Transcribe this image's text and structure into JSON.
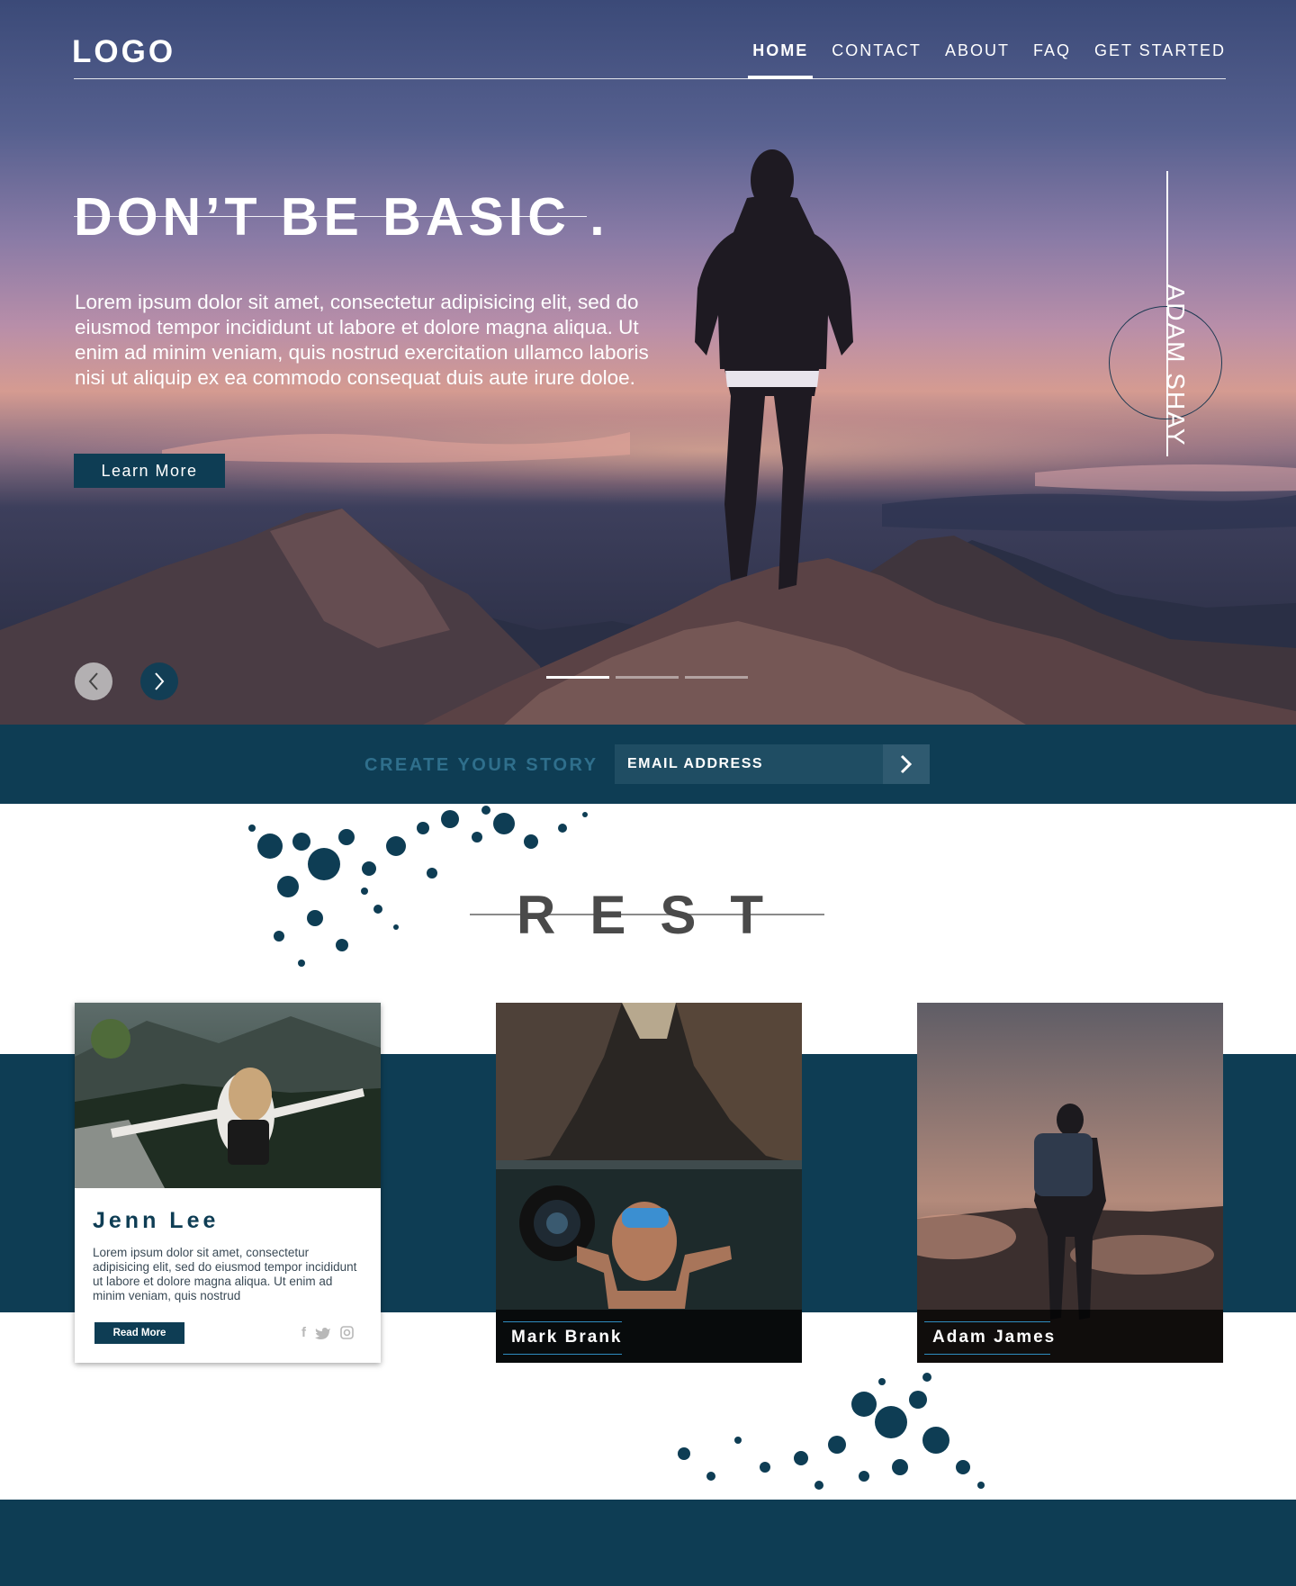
{
  "colors": {
    "primary": "#0e3d54",
    "accent": "#2f6f8c",
    "caption_rule": "#2f8cc0"
  },
  "header": {
    "logo": "LOGO",
    "nav": [
      {
        "label": "HOME",
        "active": true
      },
      {
        "label": "CONTACT",
        "active": false
      },
      {
        "label": "ABOUT",
        "active": false
      },
      {
        "label": "FAQ",
        "active": false
      },
      {
        "label": "GET STARTED",
        "active": false
      }
    ]
  },
  "hero": {
    "headline": "DON’T BE BASIC .",
    "body": "Lorem ipsum dolor sit amet, consectetur adipisicing elit, sed do eiusmod tempor incididunt ut labore et dolore magna aliqua. Ut enim ad minim veniam, quis nostrud exercitation ullamco laboris nisi ut aliquip ex ea commodo consequat duis aute irure doloe.",
    "button_label": "Learn More",
    "side_name": "ADAM SHAY",
    "slides": {
      "count": 3,
      "active_index": 0
    },
    "icons": {
      "prev": "chevron-left-icon",
      "next": "chevron-right-icon"
    }
  },
  "subscribe": {
    "cta": "CREATE YOUR STORY",
    "email_placeholder": "EMAIL ADDRESS",
    "submit_icon": "chevron-right-icon"
  },
  "section": {
    "title": "REST"
  },
  "cards": [
    {
      "name": "Jenn Lee",
      "text": "Lorem ipsum dolor sit amet, consectetur adipisicing elit, sed do eiusmod tempor incididunt ut labore et dolore magna aliqua. Ut enim ad minim veniam, quis nostrud",
      "button_label": "Read More",
      "socials": [
        "facebook-icon",
        "twitter-icon",
        "instagram-icon"
      ]
    },
    {
      "name": "Mark Brank"
    },
    {
      "name": "Adam James"
    }
  ]
}
